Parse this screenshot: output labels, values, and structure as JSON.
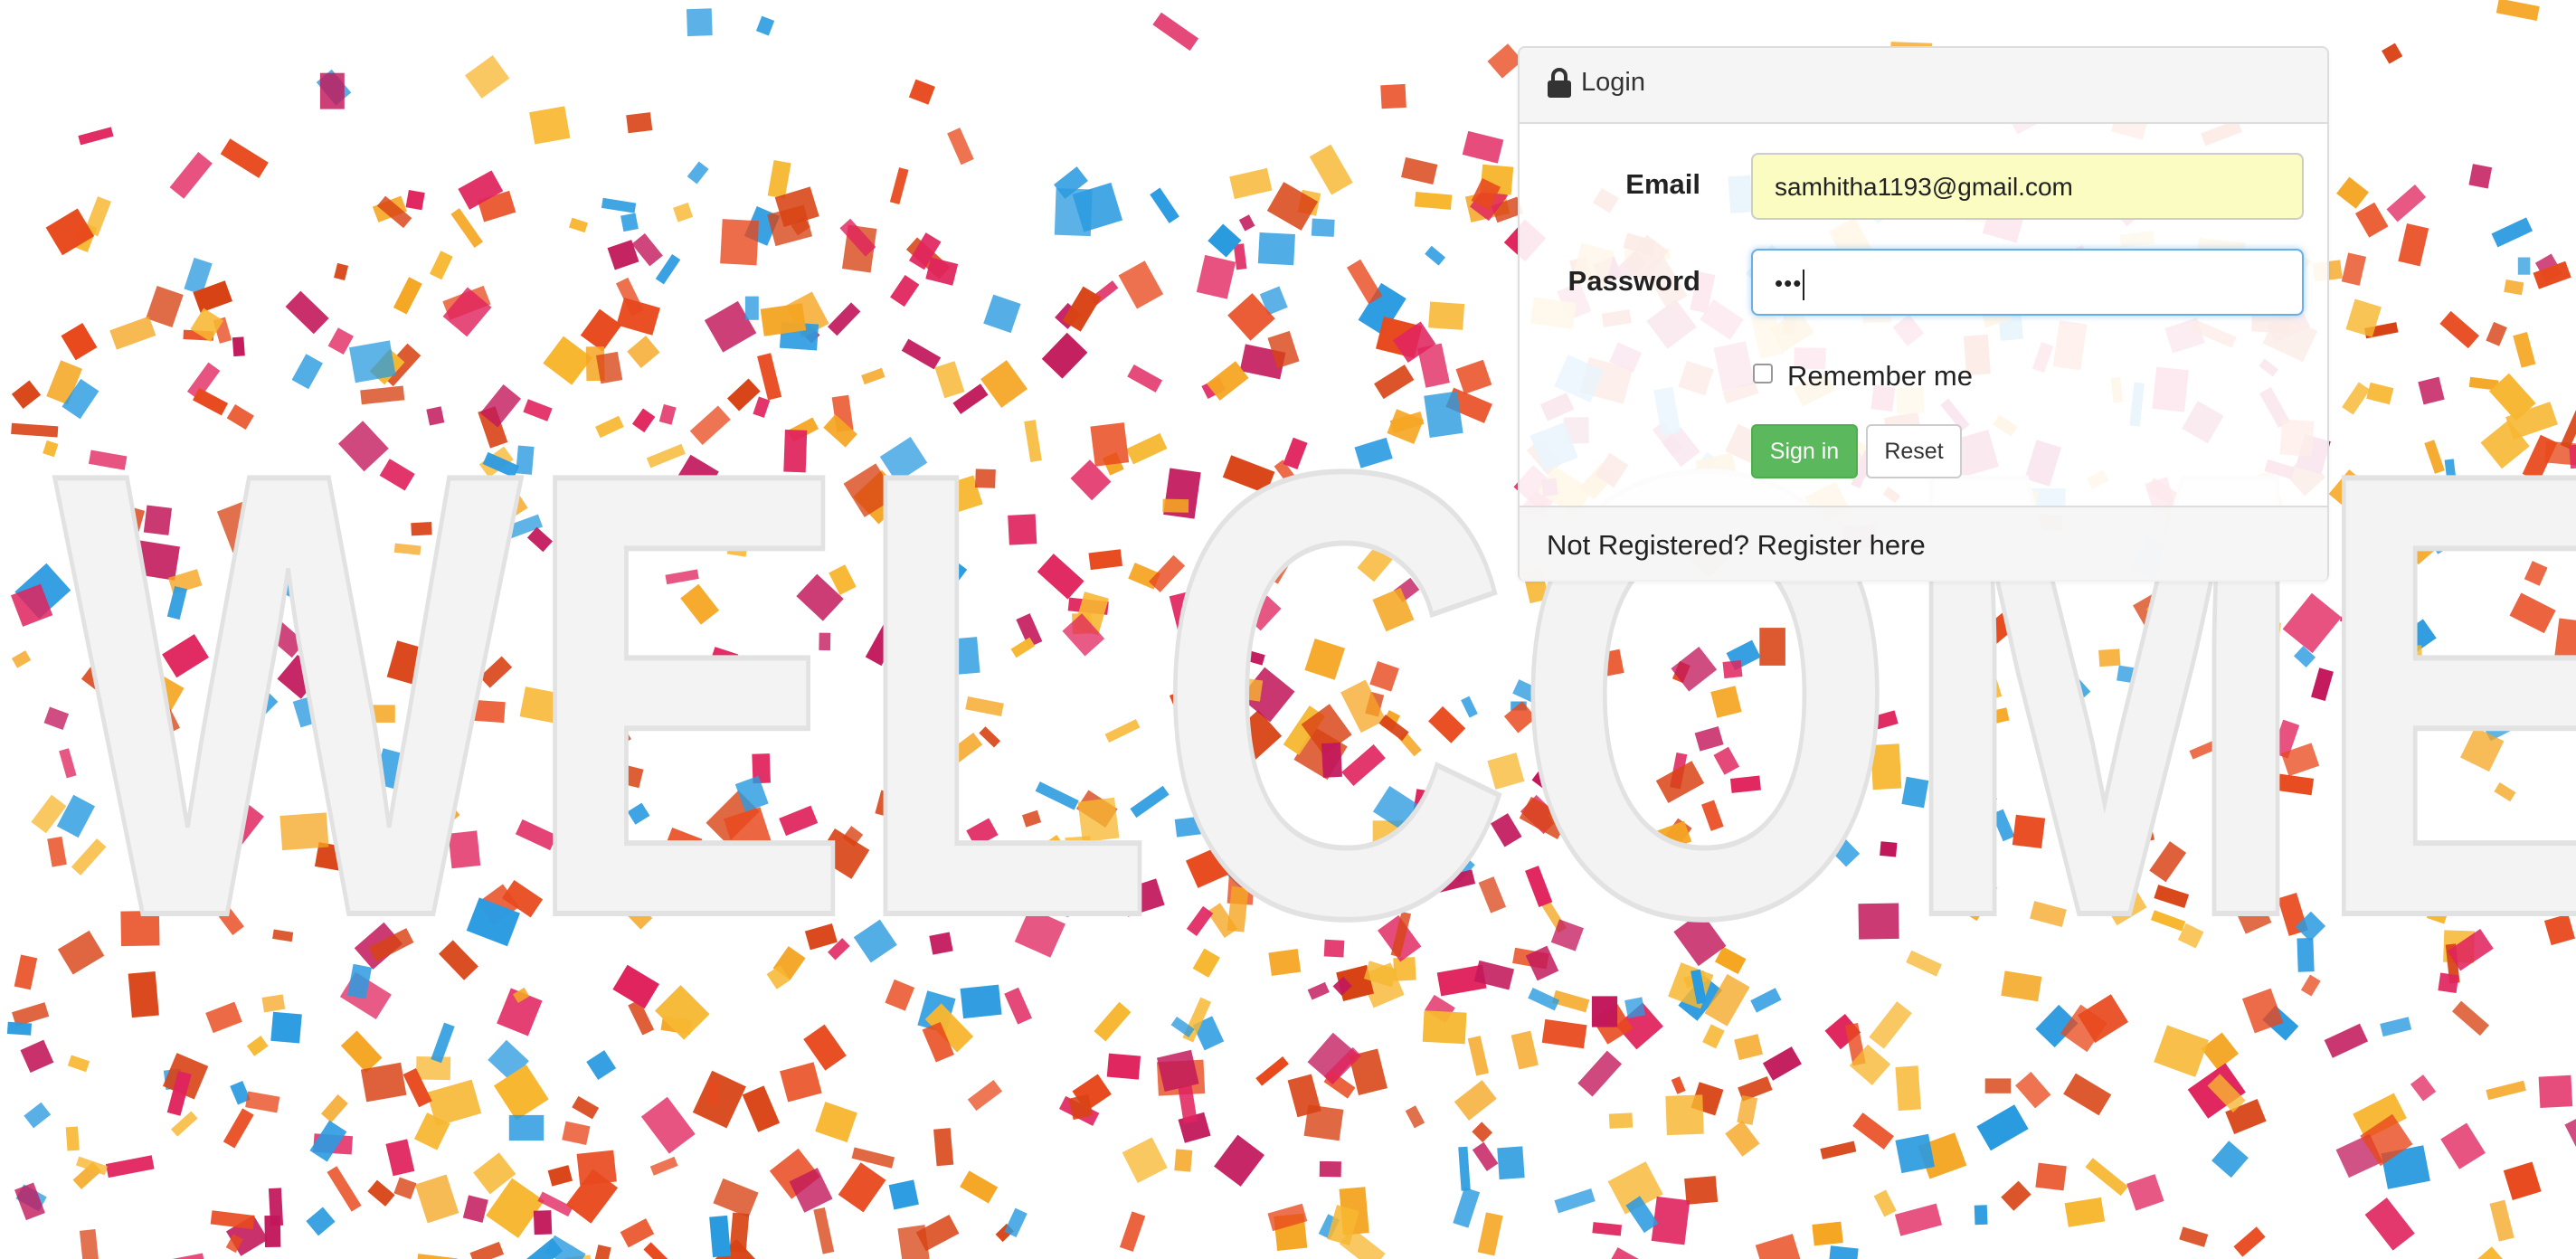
{
  "background": {
    "headline": "WELCOME"
  },
  "login": {
    "title": "Login",
    "email_label": "Email",
    "email_value": "samhitha1193@gmail.com",
    "password_label": "Password",
    "password_mask": "•••",
    "remember_label": "Remember me",
    "remember_checked": false,
    "signin_label": "Sign in",
    "reset_label": "Reset",
    "footer_text": "Not Registered? Register here"
  },
  "colors": {
    "signin_button": "#5cb85c",
    "email_autofill": "#fafcc2",
    "focus_border": "#66afe9"
  },
  "icons": {
    "login_title_icon": "lock-icon"
  }
}
